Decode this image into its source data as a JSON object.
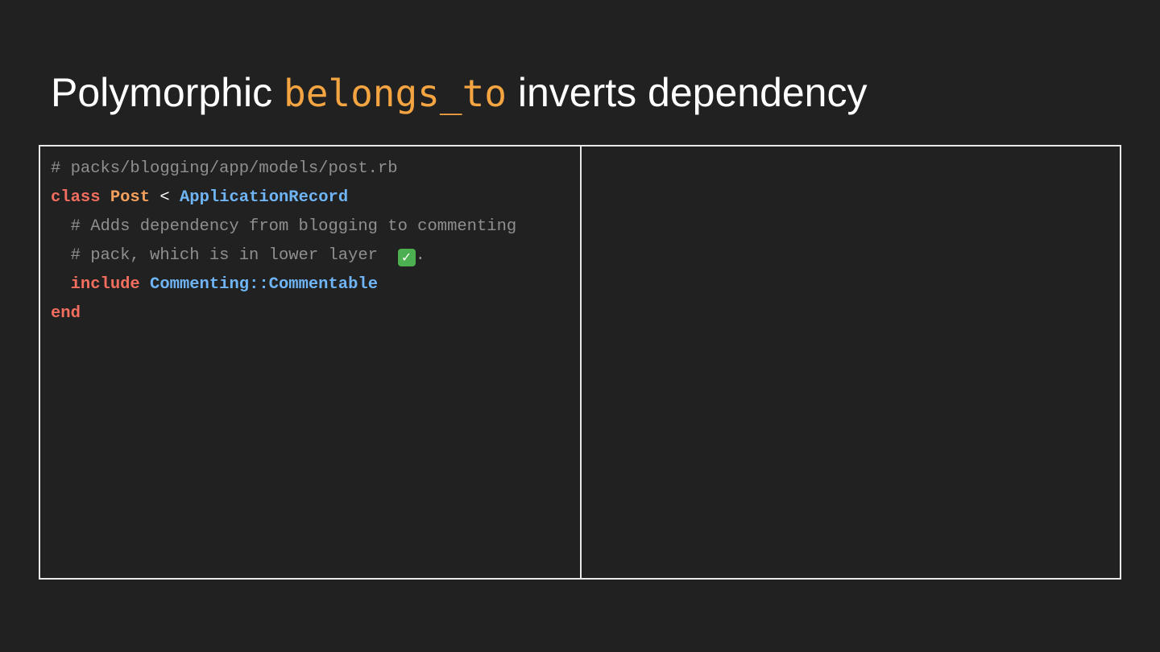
{
  "slide": {
    "title_before": "Polymorphic",
    "title_code": "belongs_to",
    "title_after": "inverts dependency"
  },
  "code": {
    "line1_comment": "# packs/blogging/app/models/post.rb",
    "line2_kw": "class",
    "line2_class": "Post",
    "line2_op": "<",
    "line2_parent": "ApplicationRecord",
    "line3_comment": "  # Adds dependency from blogging to commenting",
    "line4_comment": "  # pack, which is in lower layer ",
    "line4_check": "✓",
    "line4_tail": ".",
    "line5_indent": "  ",
    "line5_kw": "include",
    "line5_module": "Commenting::Commentable",
    "line6_kw": "end"
  },
  "icons": {
    "check": "check-mark-button-icon"
  },
  "colors": {
    "background": "#212121",
    "title_code": "#f5a442",
    "keyword": "#f36e5e",
    "class_name": "#f5a05c",
    "constant": "#6fb5f5",
    "comment": "#8f8f8f",
    "check": "#4caf50"
  }
}
